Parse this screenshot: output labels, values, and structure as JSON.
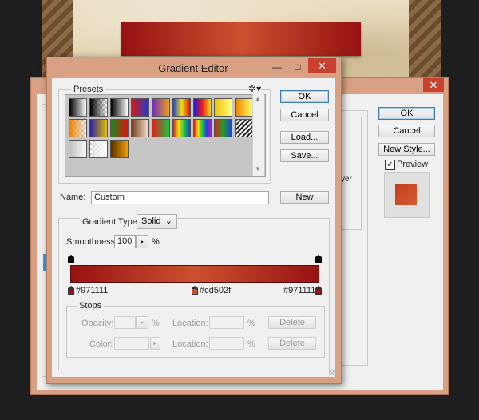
{
  "layer_style": {
    "close_glyph": "✕",
    "ok_label": "OK",
    "cancel_label": "Cancel",
    "new_style_label": "New Style...",
    "preview_label": "Preview",
    "preview_checked": true,
    "partial_text": "yer"
  },
  "gradient_editor": {
    "title": "Gradient Editor",
    "minimize_glyph": "—",
    "maximize_glyph": "□",
    "close_glyph": "✕",
    "presets_label": "Presets",
    "gear_glyph": "✲",
    "ok_label": "OK",
    "cancel_label": "Cancel",
    "load_label": "Load...",
    "save_label": "Save...",
    "name_label": "Name:",
    "name_value": "Custom",
    "new_label": "New",
    "gradient_type_label": "Gradient Type:",
    "gradient_type_value": "Solid",
    "smoothness_label": "Smoothness:",
    "smoothness_value": "100",
    "smoothness_unit": "%",
    "stops": {
      "left_color": "#971111",
      "mid_color": "#cd502f",
      "right_color": "#971111"
    },
    "stops_group_label": "Stops",
    "opacity_label": "Opacity:",
    "color_label": "Color:",
    "location_label": "Location:",
    "percent": "%",
    "delete_label": "Delete",
    "presets": [
      [
        "#000000",
        "#ffffff"
      ],
      [
        "#000000",
        "transparent"
      ],
      [
        "#000000",
        "#ffffff"
      ],
      [
        "#d41a1a",
        "#1d3bd4"
      ],
      [
        "#6a2ec4",
        "#f0a012"
      ],
      [
        "#1e40e0",
        "#f0e010",
        "#e01010"
      ],
      [
        "#1a1ae0",
        "#f01a1a",
        "#f0e010"
      ],
      [
        "#f0c000",
        "#ffff80"
      ],
      [
        "#f08000",
        "#ffff60"
      ],
      [
        "#f08000",
        "transparent"
      ],
      [
        "#3020a0",
        "#e0c000"
      ],
      [
        "#1a8a1a",
        "#e01010"
      ],
      [
        "#7a4020",
        "#f5e0d0"
      ],
      [
        "#e02020",
        "#20c040"
      ],
      [
        "#e02020",
        "#f0e010",
        "#20c040",
        "#2040e0"
      ],
      [
        "#e02020",
        "#f0e010",
        "#20c040",
        "#2040e0",
        "#a020c0"
      ],
      [
        "#e02020",
        "#20a020",
        "#2040e0"
      ],
      [
        "stripes"
      ],
      [
        "#c0c0c0",
        "#f8f8f8"
      ],
      [
        "transparent",
        "#ffffff"
      ],
      [
        "#5a3000",
        "#f0a000"
      ]
    ]
  }
}
